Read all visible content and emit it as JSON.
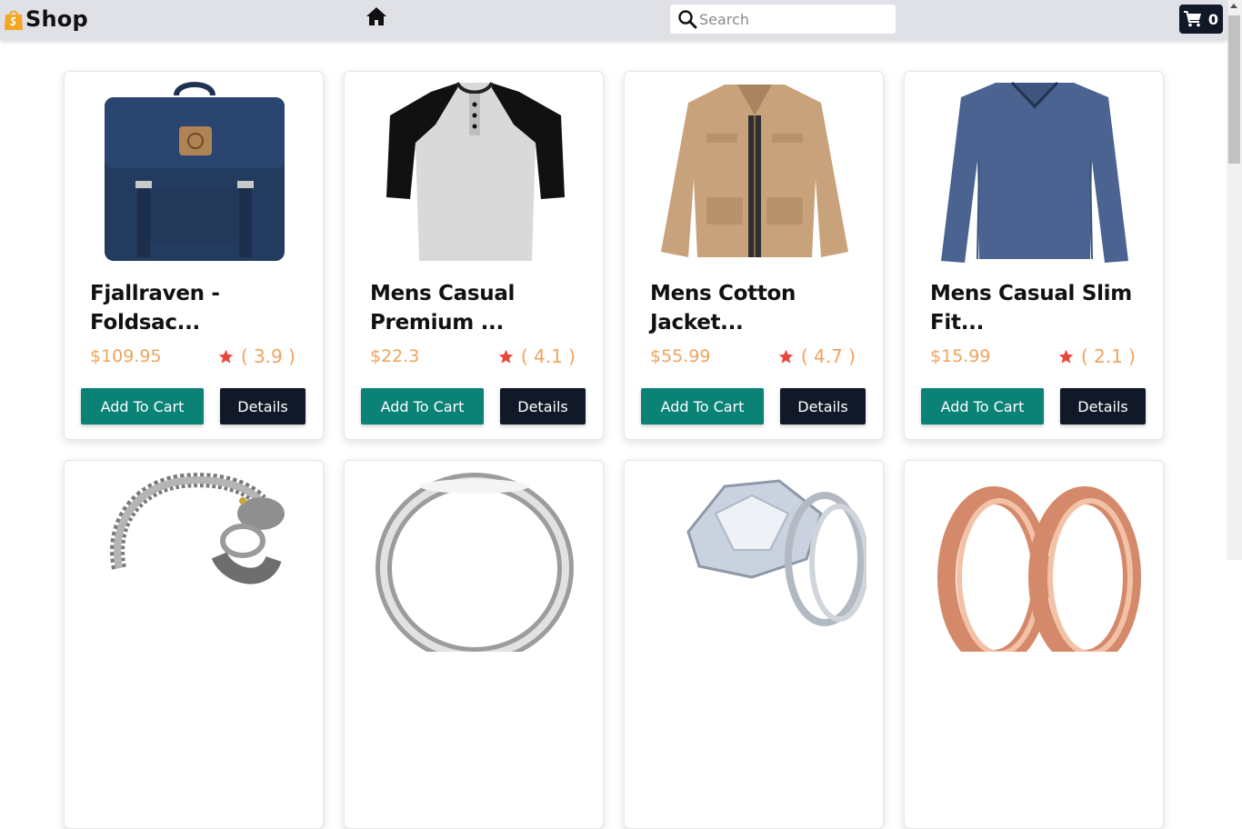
{
  "navbar": {
    "brand": "Shop",
    "search_placeholder": "Search",
    "cart_count": "0"
  },
  "products": [
    {
      "title": "Fjallraven - Foldsac...",
      "price": "$109.95",
      "rating": "( 3.9 )",
      "image": "backpack"
    },
    {
      "title": "Mens Casual Premium ...",
      "price": "$22.3",
      "rating": "( 4.1 )",
      "image": "raglan-tshirt"
    },
    {
      "title": "Mens Cotton Jacket...",
      "price": "$55.99",
      "rating": "( 4.7 )",
      "image": "cotton-jacket"
    },
    {
      "title": "Mens Casual Slim Fit...",
      "price": "$15.99",
      "rating": "( 2.1 )",
      "image": "long-sleeve-shirt"
    },
    {
      "title": "",
      "price": "",
      "rating": "",
      "image": "dragon-bracelet"
    },
    {
      "title": "",
      "price": "",
      "rating": "",
      "image": "silver-ring"
    },
    {
      "title": "",
      "price": "",
      "rating": "",
      "image": "diamond-ring"
    },
    {
      "title": "",
      "price": "",
      "rating": "",
      "image": "rose-gold-rings"
    }
  ],
  "buttons": {
    "add_to_cart": "Add To Cart",
    "details": "Details"
  },
  "colors": {
    "navbar_bg": "#dfe1e6",
    "price": "#f0a35c",
    "star": "#e8473b",
    "add_to_cart_bg": "#0b8276",
    "details_bg": "#111827"
  }
}
